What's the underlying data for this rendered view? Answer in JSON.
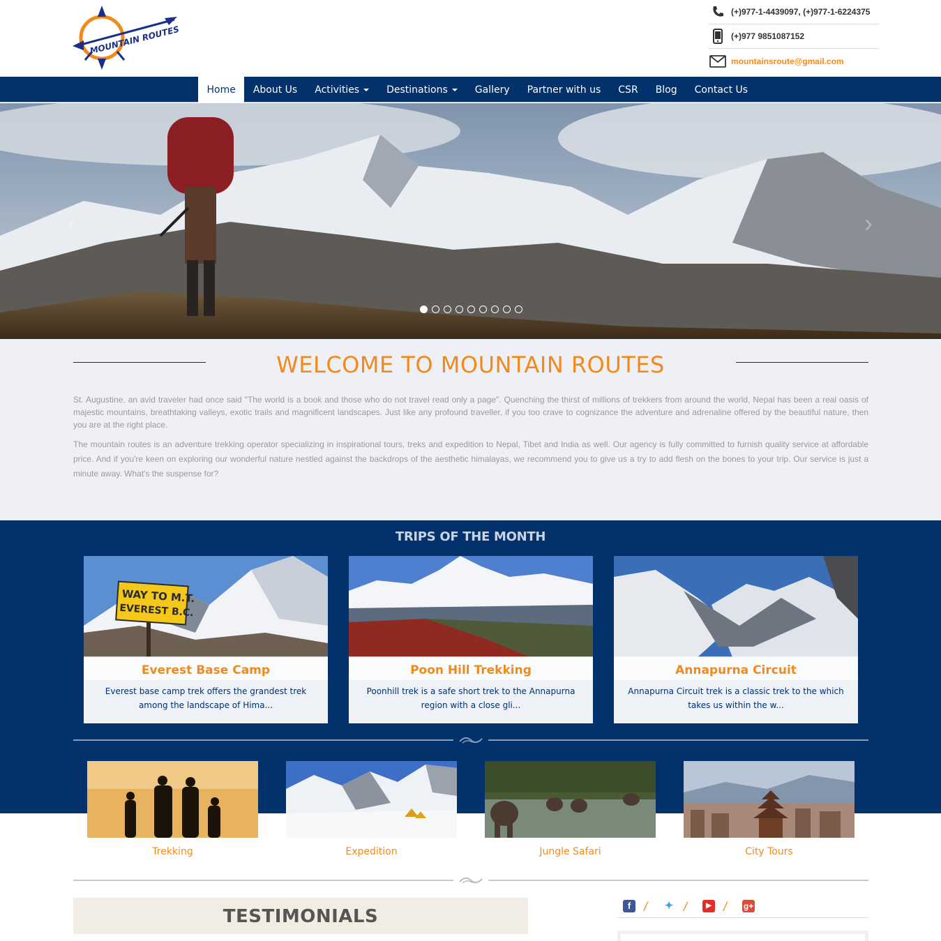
{
  "brand": {
    "logo_text": "MOUNTAIN ROUTES"
  },
  "contact": {
    "phone": "(+)977-1-4439097, (+)977-1-6224375",
    "mobile": "(+)977 9851087152",
    "email": "mountainsroute@gmail.com"
  },
  "nav": {
    "items": [
      {
        "label": "Home",
        "active": true,
        "dropdown": false
      },
      {
        "label": "About Us",
        "active": false,
        "dropdown": false
      },
      {
        "label": "Activities",
        "active": false,
        "dropdown": true
      },
      {
        "label": "Destinations",
        "active": false,
        "dropdown": true
      },
      {
        "label": "Gallery",
        "active": false,
        "dropdown": false
      },
      {
        "label": "Partner with us",
        "active": false,
        "dropdown": false
      },
      {
        "label": "CSR",
        "active": false,
        "dropdown": false
      },
      {
        "label": "Blog",
        "active": false,
        "dropdown": false
      },
      {
        "label": "Contact Us",
        "active": false,
        "dropdown": false
      }
    ]
  },
  "slider": {
    "prev_icon": "chevron-left-icon",
    "next_icon": "chevron-right-icon",
    "slide_count": 9,
    "active_slide": 1
  },
  "welcome": {
    "title": "WELCOME TO MOUNTAIN ROUTES",
    "paragraph1": "St. Augustine, an avid traveler had once said \"The world is a book and those who do not travel read only a page\". Quenching the thirst of millions of trekkers from around the world, Nepal has been a real oasis of majestic mountains, breathtaking valleys, exotic trails and magnificent landscapes. Just like any profound traveller, if you too crave to cognizance the adventure and adrenaline offered by the beautiful nature, then you are at the right place.",
    "paragraph2": "The mountain routes is an adventure trekking operator specializing in inspirational tours, treks and expedition to Nepal, Tibet and India as well. Our agency is fully committed to furnish quality service at affordable price. And if you're keen on exploring our wonderful nature nestled against the backdrops of the aesthetic himalayas, we recommend you to give us a try to add flesh on the bones to your trip. Our service is just a minute away. What's the suspense for?"
  },
  "trips": {
    "heading": "TRIPS OF THE MONTH",
    "items": [
      {
        "title": "Everest Base Camp",
        "desc": "Everest base camp trek offers the grandest trek among the landscape of Hima...",
        "sign_line1": "WAY TO M.T.",
        "sign_line2": "EVEREST B.C."
      },
      {
        "title": "Poon Hill Trekking",
        "desc": "Poonhill trek is a safe short trek to the Annapurna region with a close gli..."
      },
      {
        "title": "Annapurna Circuit",
        "desc": "Annapurna Circuit trek is a classic trek to the which takes us within the w..."
      }
    ]
  },
  "categories": [
    {
      "label": "Trekking"
    },
    {
      "label": "Expedition"
    },
    {
      "label": "Jungle Safari"
    },
    {
      "label": "City Tours"
    }
  ],
  "testimonials": {
    "heading": "TESTIMONIALS"
  },
  "social": {
    "items": [
      {
        "icon": "facebook-icon",
        "color": "#3b5998"
      },
      {
        "icon": "twitter-icon",
        "color": "#3ca6e5"
      },
      {
        "icon": "youtube-icon",
        "color": "#e52d27"
      },
      {
        "icon": "google-plus-icon",
        "color": "#dd4b39"
      }
    ]
  },
  "colors": {
    "navy": "#02316b",
    "orange": "#f28a1b",
    "light_bg": "#eef0f6"
  }
}
